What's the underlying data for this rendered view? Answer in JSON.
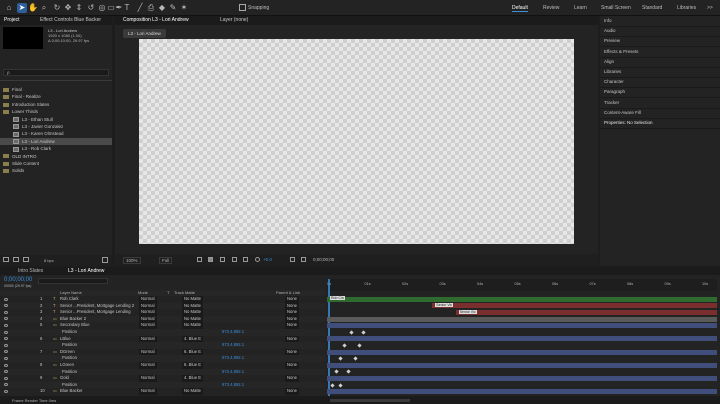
{
  "colors": {
    "accent": "#3a8fd8",
    "bar_green": "#2f6b2f",
    "bar_red": "#7a2e2e",
    "bar_blue": "#3f4e7a",
    "bar_gray": "#5a5a5a"
  },
  "workspaces": [
    "Default",
    "Review",
    "Learn",
    "Small Screen",
    "Standard",
    "Libraries"
  ],
  "toolbar": {
    "snapping": "Snapping",
    "more": ">>"
  },
  "project": {
    "tab": "Project",
    "effect_tab": "Effect Controls Blue Backer",
    "info_name": "L3 - Lori Andrew",
    "info_res": "1920 x 1080 (1.00)",
    "info_dur": "Δ 0;00;10;00, 29.97 fps",
    "search_placeholder": "ρ",
    "items": [
      {
        "label": "Final",
        "indent": 0,
        "type": "folder"
      },
      {
        "label": "Final - Realize",
        "indent": 0,
        "type": "folder"
      },
      {
        "label": "Introduction Slates",
        "indent": 0,
        "type": "folder"
      },
      {
        "label": "Lower Thirds",
        "indent": 0,
        "type": "folder"
      },
      {
        "label": "L3 - Ethan Stull",
        "indent": 1,
        "type": "comp"
      },
      {
        "label": "L3 - Javier Gonzalez",
        "indent": 1,
        "type": "comp"
      },
      {
        "label": "L3 - Karen Olmstead",
        "indent": 1,
        "type": "comp"
      },
      {
        "label": "L3 - Lori Andrew",
        "indent": 1,
        "type": "comp",
        "selected": true
      },
      {
        "label": "L3 - Rob Clark",
        "indent": 1,
        "type": "comp"
      },
      {
        "label": "OLD INTRO",
        "indent": 0,
        "type": "folder"
      },
      {
        "label": "Slide Content",
        "indent": 0,
        "type": "folder"
      },
      {
        "label": "Solids",
        "indent": 0,
        "type": "folder"
      }
    ],
    "bpc": "8 bpc"
  },
  "viewer": {
    "comp_tab": "Composition L3 - Lori Andrew",
    "layer_tab": "Layer (none)",
    "chip": "L3 - Lori Andrew",
    "zoom": "100%",
    "quality": "Full",
    "exposure": "+0.0",
    "timecode": "0;00;00;00"
  },
  "rightpanel": {
    "items": [
      "Info",
      "Audio",
      "Preview",
      "Effects & Presets",
      "Align",
      "Libraries",
      "Character",
      "Paragraph",
      "Tracker",
      "Content-Aware Fill",
      "Properties: No Selection"
    ]
  },
  "timeline": {
    "tabs": [
      "Intro Slates",
      "L3 - Lori Andrew"
    ],
    "timecode": "0;00;00;00",
    "fps": "00000 (29.97 fps)",
    "headers": {
      "layer_name": "Layer Name",
      "mode": "Mode",
      "t": "T",
      "trkmat": "Track Matte",
      "parent": "Parent & Link"
    },
    "ruler": [
      "0s",
      "01s",
      "02s",
      "03s",
      "04s",
      "05s",
      "06s",
      "07s",
      "08s",
      "09s",
      "10s"
    ],
    "footer": "Frame Render Time 0ms",
    "rows": [
      {
        "num": "1",
        "type": "T",
        "name": "Rob Clark",
        "mode": "Normal",
        "matte": "No Matte",
        "parent": "None"
      },
      {
        "num": "2",
        "type": "T",
        "name": "Senior ...President, Mortgage Lending 2",
        "mode": "Normal",
        "matte": "No Matte",
        "parent": "None"
      },
      {
        "num": "3",
        "type": "T",
        "name": "Senior ...President, Mortgage Lending",
        "mode": "Normal",
        "matte": "No Matte",
        "parent": "None"
      },
      {
        "num": "4",
        "type": "▭",
        "name": "Blue Backer 2",
        "mode": "Normal",
        "matte": "No Matte",
        "parent": "None"
      },
      {
        "num": "5",
        "type": "▭",
        "name": "Secondary Blue",
        "mode": "Normal",
        "matte": "No Matte",
        "parent": "None"
      },
      {
        "prop": "Position",
        "value": "973.4,892.1"
      },
      {
        "num": "6",
        "type": "▭",
        "name": "LBlue",
        "mode": "Normal",
        "matte": "4. Blue E",
        "parent": "None"
      },
      {
        "prop": "Position",
        "value": "973.4,892.1"
      },
      {
        "num": "7",
        "type": "▭",
        "name": "DGreen",
        "mode": "Normal",
        "matte": "6. Blue E",
        "parent": "None"
      },
      {
        "prop": "Position",
        "value": "973.4,892.1"
      },
      {
        "num": "8",
        "type": "▭",
        "name": "LGreen",
        "mode": "Normal",
        "matte": "6. Blue E",
        "parent": "None"
      },
      {
        "prop": "Position",
        "value": "973.4,892.1"
      },
      {
        "num": "9",
        "type": "▭",
        "name": "Gold",
        "mode": "Normal",
        "matte": "4. Blue E",
        "parent": "None"
      },
      {
        "prop": "Position",
        "value": "973.4,892.1"
      },
      {
        "num": "10",
        "type": "▭",
        "name": "Blue Backer",
        "mode": "Normal",
        "matte": "No Matte",
        "parent": "None"
      }
    ],
    "bar_labels": [
      "Rob Cla",
      "Senior Vic",
      "Senior Vic"
    ]
  }
}
